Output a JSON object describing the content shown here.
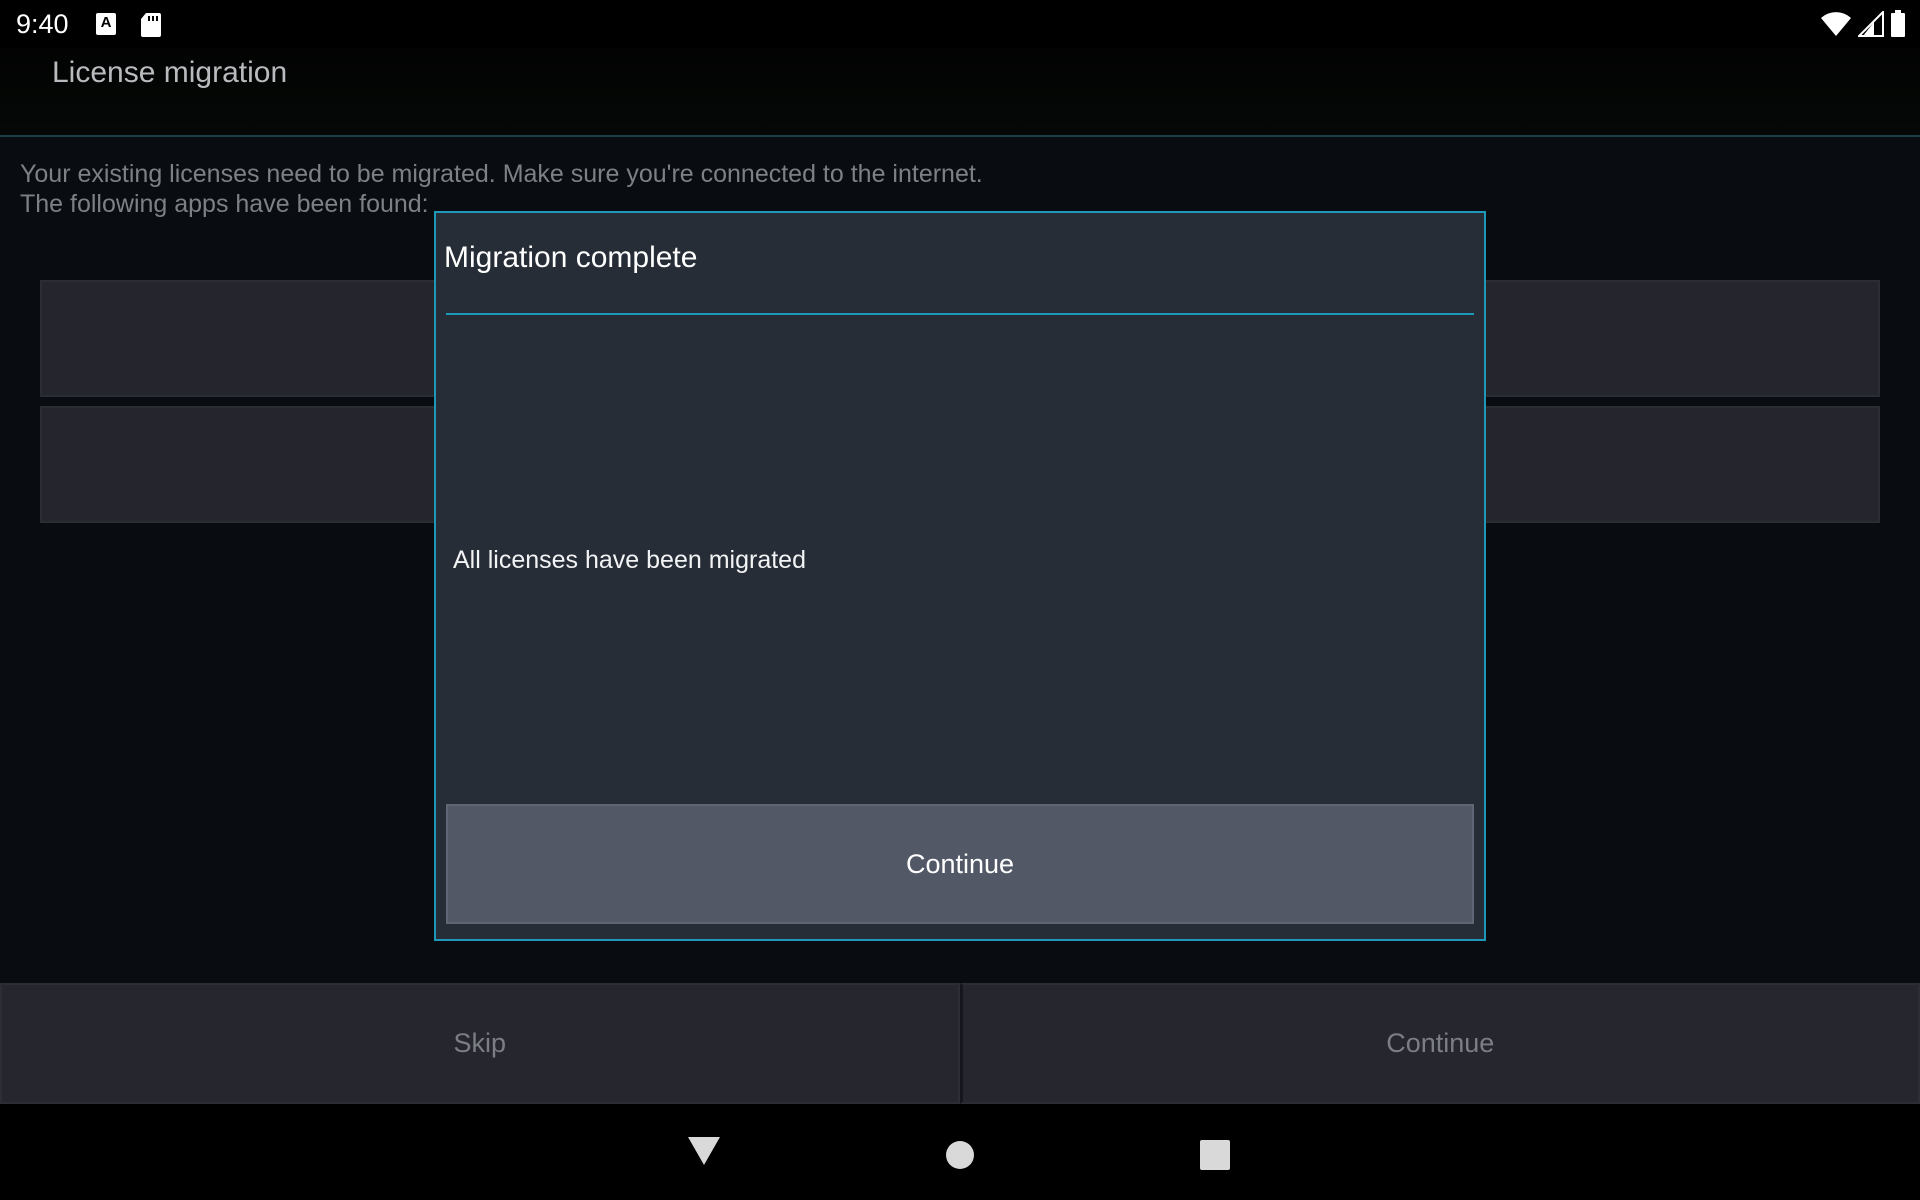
{
  "status_bar": {
    "time": "9:40",
    "notification_icons": [
      "accessibility-a-icon",
      "sd-card-icon"
    ],
    "system_icons": [
      "wifi-icon",
      "cell-signal-icon",
      "battery-icon"
    ]
  },
  "app_bar": {
    "title": "License migration"
  },
  "content": {
    "intro_line_1": "Your existing licenses need to be migrated. Make sure you're connected to the internet.",
    "intro_line_2": "The following apps have been found:"
  },
  "bottom_actions": {
    "skip_label": "Skip",
    "continue_label": "Continue"
  },
  "dialog": {
    "title": "Migration complete",
    "message": "All licenses have been migrated",
    "button_label": "Continue"
  },
  "colors": {
    "accent": "#1e98b8",
    "dialog_background": "#272d37",
    "dialog_button": "#535867",
    "screen_background": "#090c10"
  },
  "nav_bar": {
    "icons": [
      "back-icon",
      "home-icon",
      "recents-icon"
    ]
  }
}
